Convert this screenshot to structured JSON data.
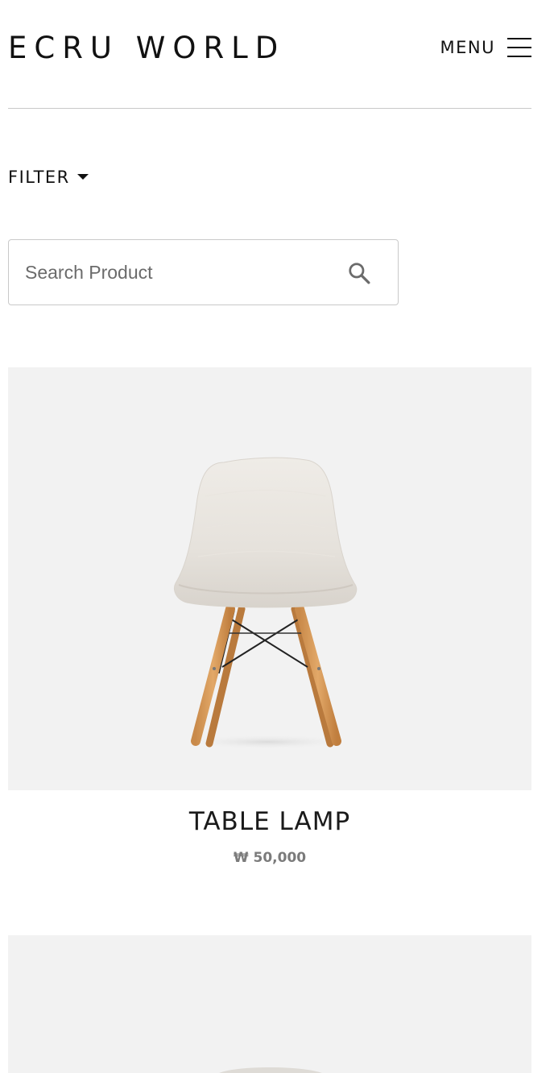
{
  "header": {
    "logo": "ECRU WORLD",
    "menu_label": "MENU"
  },
  "filter": {
    "label": "FILTER"
  },
  "search": {
    "placeholder": "Search Product",
    "value": ""
  },
  "products": [
    {
      "name": "TABLE LAMP",
      "price": "₩ 50,000",
      "image_icon": "chair-icon"
    },
    {
      "name": "",
      "price": "",
      "image_icon": "chair-icon"
    }
  ],
  "colors": {
    "text": "#111111",
    "divider": "#c8c8c8",
    "image_bg": "#f2f2f2",
    "price": "#7b7b7b",
    "search_border": "#c9c9c9"
  }
}
